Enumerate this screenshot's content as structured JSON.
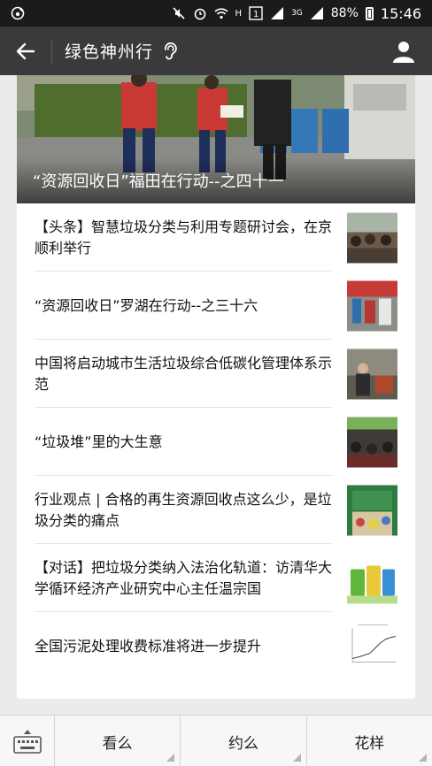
{
  "status_bar": {
    "app_icon": "weibo-icon",
    "network_h": "H",
    "network_3g": "3G",
    "battery": "88%",
    "time": "15:46"
  },
  "header": {
    "title": "绿色神州行",
    "back_icon": "arrow-left-icon",
    "ear_icon": "ear-icon",
    "profile_icon": "person-icon"
  },
  "hero": {
    "caption": "“资源回收日”福田在行动--之四十一"
  },
  "articles": [
    {
      "title": "【头条】智慧垃圾分类与利用专题研讨会，在京顺利举行"
    },
    {
      "title": "“资源回收日”罗湖在行动--之三十六"
    },
    {
      "title": "中国将启动城市生活垃圾综合低碳化管理体系示范"
    },
    {
      "title": "“垃圾堆”里的大生意"
    },
    {
      "title": "行业观点 | 合格的再生资源回收点这么少，是垃圾分类的痛点"
    },
    {
      "title": "【对话】把垃圾分类纳入法治化轨道：访清华大学循环经济产业研究中心主任温宗国"
    },
    {
      "title": "全国污泥处理收费标准将进一步提升"
    }
  ],
  "bottom_menu": {
    "keyboard_icon": "keyboard-icon",
    "items": [
      "看么",
      "约么",
      "花样"
    ]
  },
  "colors": {
    "title_bar": "#3a3a3c",
    "status_bar": "#1b1b1b",
    "background": "#ebebeb"
  }
}
